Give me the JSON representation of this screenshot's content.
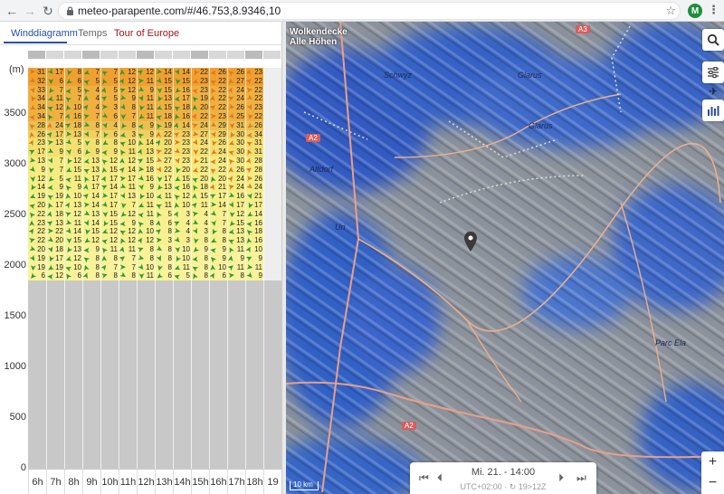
{
  "browser": {
    "url": "meteo-parapente.com/#/46.753,8.9346,10",
    "back_icon": "arrow-left-icon",
    "forward_icon": "arrow-right-icon",
    "reload_icon": "reload-icon",
    "avatar_letter": "M"
  },
  "tabs": [
    {
      "label": "Winddiagramm",
      "active": true
    },
    {
      "label": "Temps",
      "active": false
    },
    {
      "label": "Tour of Europe",
      "active": false
    }
  ],
  "diagram": {
    "y_unit": "(m)",
    "y_ticks": [
      "3500",
      "3000",
      "2500",
      "2000",
      "1500",
      "1000",
      "500",
      "0"
    ],
    "hours": [
      "6h",
      "7h",
      "8h",
      "9h",
      "10h",
      "11h",
      "12h",
      "13h",
      "14h",
      "15h",
      "16h",
      "17h",
      "18h",
      "19"
    ],
    "rows": [
      [
        "31",
        "17",
        "8",
        "7",
        "7",
        "12",
        "12",
        "14",
        "14",
        "22",
        "26",
        "26",
        "23",
        ""
      ],
      [
        "32",
        "6",
        "6",
        "5",
        "5",
        "12",
        "11",
        "15",
        "15",
        "23",
        "22",
        "27",
        "22",
        ""
      ],
      [
        "33",
        "7",
        "5",
        "4",
        "5",
        "12",
        "9",
        "15",
        "16",
        "23",
        "22",
        "24",
        "22",
        ""
      ],
      [
        "34",
        "11",
        "7",
        "4",
        "5",
        "9",
        "11",
        "13",
        "17",
        "19",
        "22",
        "24",
        "22",
        ""
      ],
      [
        "34",
        "12",
        "10",
        "4",
        "3",
        "8",
        "11",
        "15",
        "18",
        "20",
        "22",
        "26",
        "23",
        ""
      ],
      [
        "34",
        "7",
        "16",
        "7",
        "6",
        "7",
        "11",
        "18",
        "16",
        "22",
        "23",
        "25",
        "22",
        ""
      ],
      [
        "28",
        "24",
        "18",
        "8",
        "4",
        "8",
        "9",
        "19",
        "14",
        "24",
        "29",
        "31",
        "26",
        ""
      ],
      [
        "26",
        "17",
        "13",
        "7",
        "6",
        "3",
        "9",
        "22",
        "23",
        "27",
        "29",
        "30",
        "34",
        ""
      ],
      [
        "23",
        "13",
        "5",
        "8",
        "8",
        "10",
        "14",
        "20",
        "23",
        "24",
        "26",
        "30",
        "31",
        ""
      ],
      [
        "17",
        "9",
        "6",
        "9",
        "9",
        "11",
        "13",
        "22",
        "23",
        "22",
        "24",
        "30",
        "31",
        ""
      ],
      [
        "13",
        "7",
        "12",
        "13",
        "12",
        "12",
        "15",
        "27",
        "23",
        "21",
        "24",
        "30",
        "28",
        ""
      ],
      [
        "9",
        "7",
        "15",
        "13",
        "15",
        "14",
        "18",
        "22",
        "20",
        "22",
        "22",
        "26",
        "28",
        ""
      ],
      [
        "12",
        "5",
        "11",
        "17",
        "17",
        "17",
        "16",
        "17",
        "15",
        "20",
        "20",
        "24",
        "26",
        ""
      ],
      [
        "14",
        "9",
        "9",
        "17",
        "14",
        "11",
        "9",
        "13",
        "16",
        "18",
        "21",
        "24",
        "24",
        ""
      ],
      [
        "19",
        "19",
        "10",
        "14",
        "17",
        "13",
        "10",
        "11",
        "12",
        "15",
        "17",
        "16",
        "21",
        ""
      ],
      [
        "20",
        "17",
        "13",
        "14",
        "17",
        "7",
        "11",
        "11",
        "10",
        "11",
        "14",
        "17",
        "17",
        ""
      ],
      [
        "22",
        "18",
        "12",
        "13",
        "15",
        "12",
        "11",
        "5",
        "3",
        "4",
        "7",
        "12",
        "14",
        ""
      ],
      [
        "23",
        "13",
        "11",
        "14",
        "15",
        "9",
        "8",
        "6",
        "4",
        "4",
        "7",
        "15",
        "16",
        ""
      ],
      [
        "22",
        "22",
        "14",
        "15",
        "12",
        "12",
        "10",
        "8",
        "4",
        "3",
        "8",
        "13",
        "18",
        ""
      ],
      [
        "22",
        "20",
        "15",
        "12",
        "12",
        "12",
        "12",
        "3",
        "3",
        "8",
        "8",
        "13",
        "16",
        ""
      ],
      [
        "20",
        "18",
        "13",
        "9",
        "11",
        "11",
        "8",
        "8",
        "10",
        "9",
        "9",
        "11",
        "10",
        ""
      ],
      [
        "19",
        "17",
        "12",
        "8",
        "8",
        "7",
        "8",
        "8",
        "10",
        "8",
        "9",
        "9",
        "9",
        ""
      ],
      [
        "19",
        "19",
        "10",
        "8",
        "7",
        "7",
        "10",
        "8",
        "11",
        "8",
        "10",
        "11",
        "11",
        ""
      ],
      [
        "6",
        "12",
        "6",
        "8",
        "8",
        "8",
        "11",
        "6",
        "5",
        "8",
        "6",
        "8",
        "9",
        ""
      ]
    ],
    "row_colors": [
      "#f0a030",
      "#f0a030",
      "#f0b040",
      "#f0b040",
      "#f0b040",
      "#f0b040",
      "#ecc050",
      "#f2d060",
      "#f4e070",
      "#f4e070",
      "#f6ea80",
      "#f6ea80",
      "#f6ec84",
      "#f6ec84",
      "#f7ee88",
      "#f7ee88",
      "#f8f090",
      "#f8f090",
      "#f8f090",
      "#f8f090",
      "#f9f29a",
      "#f9f29a",
      "#f9f29a",
      "#f9f29a"
    ]
  },
  "map": {
    "overlay_title_line1": "Wolkendecke",
    "overlay_title_line2": "Alle Höhen",
    "place_labels": [
      "Schwyz",
      "Glarus",
      "Altdorf",
      "Glarus",
      "Uri",
      "Parc Ela"
    ],
    "road_badges": [
      "A3",
      "A2",
      "A2"
    ],
    "scale": "10 km",
    "side_buttons": [
      "search-icon",
      "sliders-icon",
      "plane-icon",
      "chart-icon"
    ]
  },
  "timebar": {
    "datetime": "Mi. 21. - 14:00",
    "tz": "UTC+02:00 · ↻ 19>12Z"
  },
  "zoom": {
    "in": "+",
    "out": "−"
  }
}
